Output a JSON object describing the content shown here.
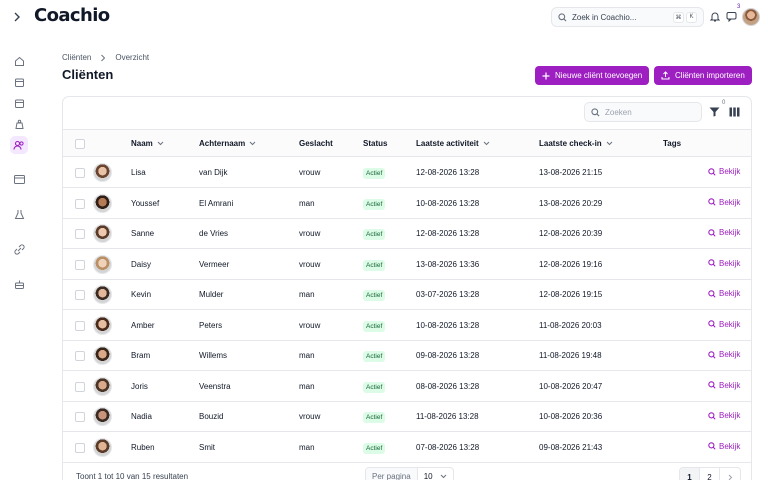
{
  "app": {
    "logo": "Coachio"
  },
  "topbar": {
    "search_placeholder": "Zoek in Coachio...",
    "shortcut_keys": [
      "⌘",
      "K"
    ],
    "chat_badge": "3"
  },
  "breadcrumb": [
    "Cliënten",
    "Overzicht"
  ],
  "page": {
    "title": "Cliënten",
    "add_button": "Nieuwe cliënt toevoegen",
    "import_button": "Cliënten importeren"
  },
  "table": {
    "search_placeholder": "Zoeken",
    "filter_count": "0",
    "columns": [
      "Naam",
      "Achternaam",
      "Geslacht",
      "Status",
      "Laatste activiteit",
      "Laatste check-in",
      "Tags"
    ],
    "action_label": "Bekijk",
    "rows": [
      {
        "first": "Lisa",
        "last": "van Dijk",
        "gender": "vrouw",
        "status": "Actief",
        "activity": "12-08-2026 13:28",
        "checkin": "13-08-2026 21:15"
      },
      {
        "first": "Youssef",
        "last": "El Amrani",
        "gender": "man",
        "status": "Actief",
        "activity": "10-08-2026 13:28",
        "checkin": "13-08-2026 20:29"
      },
      {
        "first": "Sanne",
        "last": "de Vries",
        "gender": "vrouw",
        "status": "Actief",
        "activity": "12-08-2026 13:28",
        "checkin": "12-08-2026 20:39"
      },
      {
        "first": "Daisy",
        "last": "Vermeer",
        "gender": "vrouw",
        "status": "Actief",
        "activity": "13-08-2026 13:36",
        "checkin": "12-08-2026 19:16"
      },
      {
        "first": "Kevin",
        "last": "Mulder",
        "gender": "man",
        "status": "Actief",
        "activity": "03-07-2026 13:28",
        "checkin": "12-08-2026 19:15"
      },
      {
        "first": "Amber",
        "last": "Peters",
        "gender": "vrouw",
        "status": "Actief",
        "activity": "10-08-2026 13:28",
        "checkin": "11-08-2026 20:03"
      },
      {
        "first": "Bram",
        "last": "Willems",
        "gender": "man",
        "status": "Actief",
        "activity": "09-08-2026 13:28",
        "checkin": "11-08-2026 19:48"
      },
      {
        "first": "Joris",
        "last": "Veenstra",
        "gender": "man",
        "status": "Actief",
        "activity": "08-08-2026 13:28",
        "checkin": "10-08-2026 20:47"
      },
      {
        "first": "Nadia",
        "last": "Bouzid",
        "gender": "vrouw",
        "status": "Actief",
        "activity": "11-08-2026 13:28",
        "checkin": "10-08-2026 20:36"
      },
      {
        "first": "Ruben",
        "last": "Smit",
        "gender": "man",
        "status": "Actief",
        "activity": "07-08-2026 13:28",
        "checkin": "09-08-2026 21:43"
      }
    ]
  },
  "footer": {
    "results_text": "Toont 1 tot 10 van 15 resultaten",
    "per_page_label": "Per pagina",
    "per_page_value": "10",
    "pages": [
      "1",
      "2"
    ],
    "current_page": "1"
  },
  "colors": {
    "accent": "#9d1ec1",
    "status_bg": "#dcfce7",
    "status_text": "#166534"
  },
  "icons": {
    "sidebar": [
      "home-icon",
      "calendar-icon",
      "calendar-icon",
      "scale-icon",
      "users-icon",
      "credit-card-icon",
      "flask-icon",
      "link-icon",
      "cake-icon"
    ]
  }
}
